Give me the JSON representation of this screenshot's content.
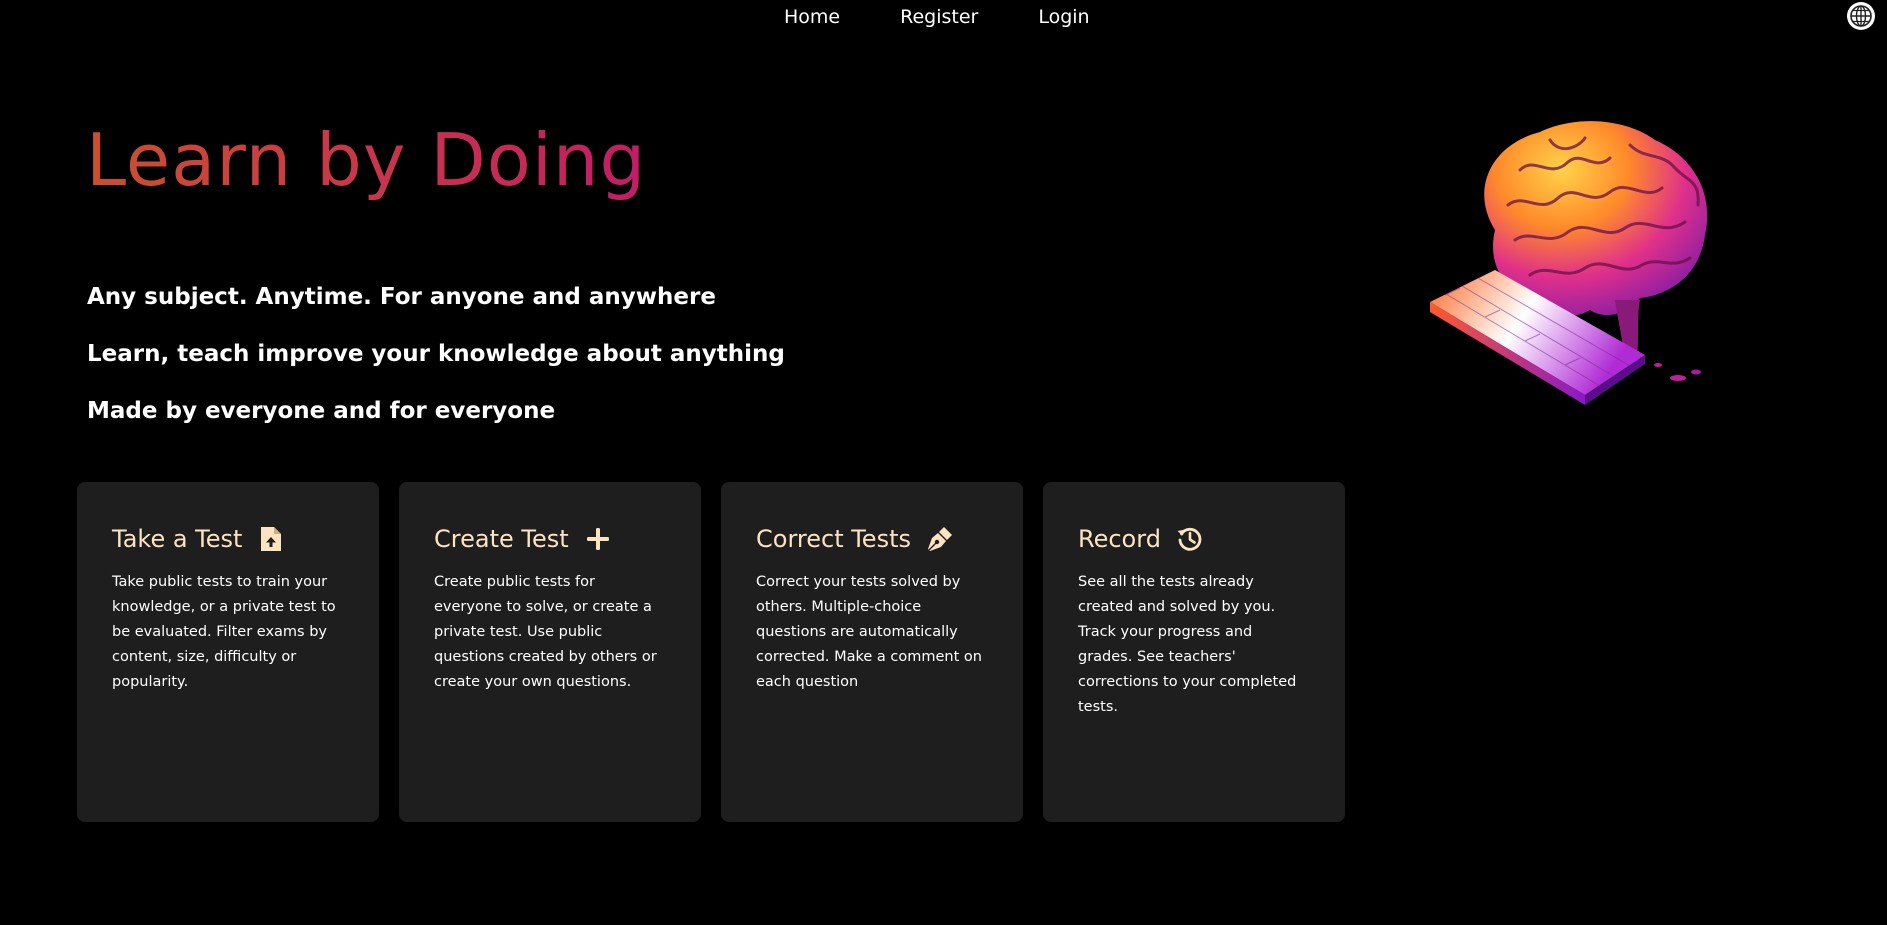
{
  "nav": {
    "links": [
      "Home",
      "Register",
      "Login"
    ],
    "language_icon": "globe-icon"
  },
  "hero": {
    "title": "Learn by Doing",
    "taglines": [
      "Any subject. Anytime. For anyone and anywhere",
      "Learn, teach improve your knowledge about anything",
      "Made by everyone and for everyone"
    ],
    "image": "brain-keyboard-illustration"
  },
  "cards": [
    {
      "title": "Take a Test",
      "icon": "file-upload-icon",
      "description": "Take public tests to train your knowledge, or a private test to be evaluated. Filter exams by content, size, difficulty or popularity."
    },
    {
      "title": "Create Test",
      "icon": "plus-icon",
      "description": "Create public tests for everyone to solve, or create a private test. Use public questions created by others or create your own questions."
    },
    {
      "title": "Correct Tests",
      "icon": "pen-nib-icon",
      "description": "Correct your tests solved by others. Multiple-choice questions are automatically corrected. Make a comment on each question"
    },
    {
      "title": "Record",
      "icon": "history-icon",
      "description": "See all the tests already created and solved by you. Track your progress and grades. See teachers' corrections to your completed tests."
    }
  ],
  "colors": {
    "background": "#000000",
    "card_background": "#1e1e1e",
    "card_title": "#fde4c0",
    "title_gradient_start": "#c9502f",
    "title_gradient_end": "#c21d66"
  }
}
